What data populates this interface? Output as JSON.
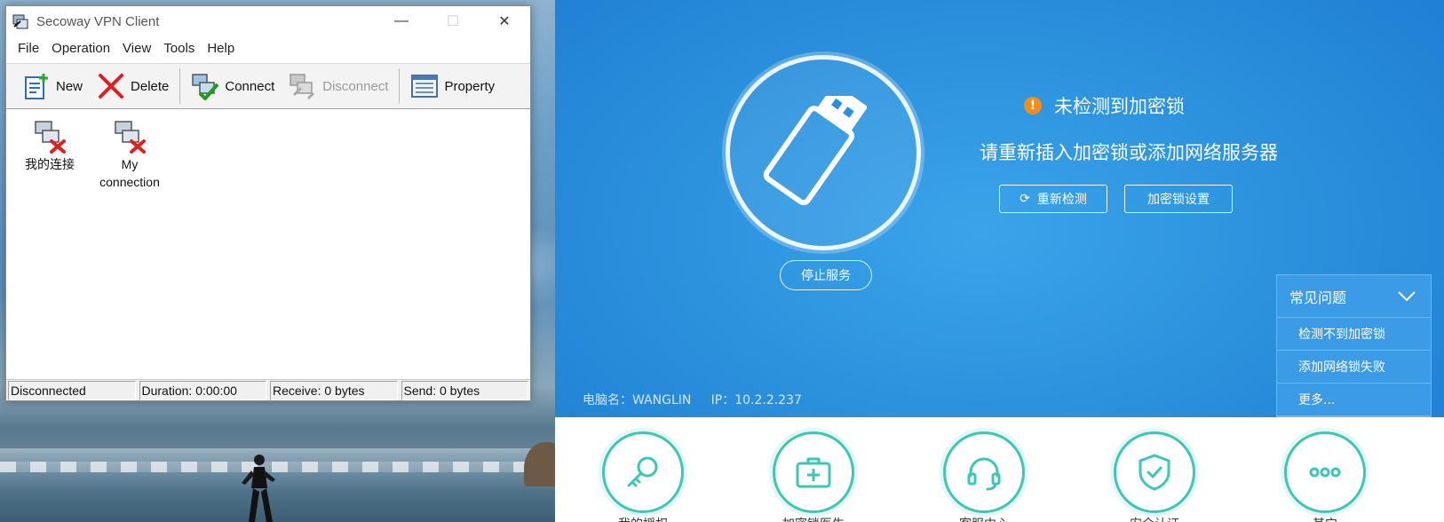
{
  "vpn_window": {
    "title": "Secoway VPN Client",
    "menu": [
      "File",
      "Operation",
      "View",
      "Tools",
      "Help"
    ],
    "toolbar": {
      "new": "New",
      "delete": "Delete",
      "connect": "Connect",
      "disconnect": "Disconnect",
      "property": "Property"
    },
    "connections": [
      {
        "label": "我的连接"
      },
      {
        "label": "My connection"
      }
    ],
    "status": {
      "state": "Disconnected",
      "duration": "Duration: 0:00:00",
      "receive": "Receive: 0 bytes",
      "send": "Send: 0 bytes"
    }
  },
  "panel": {
    "warning": "未检测到加密锁",
    "subtitle": "请重新插入加密锁或添加网络服务器",
    "redetect_button": "重新检测",
    "lock_settings_button": "加密锁设置",
    "stop_service_button": "停止服务",
    "machine_info": "电脑名：WANGLIN     IP：10.2.2.237",
    "faq": {
      "title": "常见问题",
      "items": [
        "检测不到加密锁",
        "添加网络锁失败",
        "更多..."
      ]
    },
    "nav": [
      {
        "label": "我的授权",
        "icon": "key-icon"
      },
      {
        "label": "加密锁医生",
        "icon": "medical-kit-icon"
      },
      {
        "label": "客服中心",
        "icon": "headset-icon"
      },
      {
        "label": "安全认证",
        "icon": "shield-check-icon"
      },
      {
        "label": "其它",
        "icon": "more-dots-icon"
      }
    ],
    "colors": {
      "hero_blue": "#2a8fdc",
      "accent_teal": "#3cc6b6",
      "warning_orange": "#f68b1f"
    }
  }
}
